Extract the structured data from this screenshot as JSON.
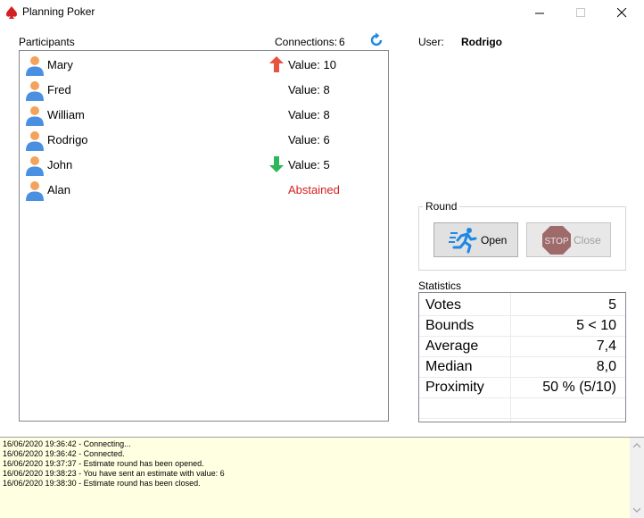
{
  "window": {
    "title": "Planning Poker",
    "minimize_icon": "minimize-icon",
    "maximize_icon": "maximize-icon",
    "close_icon": "close-icon"
  },
  "participants": {
    "label": "Participants",
    "connections_label": "Connections:",
    "connections_count": "6",
    "list": [
      {
        "name": "Mary",
        "value": "Value: 10",
        "indicator": "arrow-up",
        "abstained": false
      },
      {
        "name": "Fred",
        "value": "Value: 8",
        "indicator": "",
        "abstained": false
      },
      {
        "name": "William",
        "value": "Value: 8",
        "indicator": "",
        "abstained": false
      },
      {
        "name": "Rodrigo",
        "value": "Value: 6",
        "indicator": "",
        "abstained": false
      },
      {
        "name": "John",
        "value": "Value: 5",
        "indicator": "arrow-down",
        "abstained": false
      },
      {
        "name": "Alan",
        "value": "Abstained",
        "indicator": "",
        "abstained": true
      }
    ]
  },
  "user": {
    "label": "User:",
    "name": "Rodrigo"
  },
  "round": {
    "label": "Round",
    "open_label": "Open",
    "close_label": "Close",
    "stop_text": "STOP"
  },
  "statistics": {
    "label": "Statistics",
    "rows": [
      {
        "label": "Votes",
        "value": "5"
      },
      {
        "label": "Bounds",
        "value": "5 < 10"
      },
      {
        "label": "Average",
        "value": "7,4"
      },
      {
        "label": "Median",
        "value": "8,0"
      },
      {
        "label": "Proximity",
        "value": "50 % (5/10)"
      }
    ]
  },
  "log": [
    "16/06/2020 19:36:42 - Connecting...",
    "16/06/2020 19:36:42 - Connected.",
    "16/06/2020 19:37:37 - Estimate round has been opened.",
    "16/06/2020 19:38:23 - You have sent an estimate with value: 6",
    "16/06/2020 19:38:30 - Estimate round has been closed."
  ],
  "colors": {
    "arrow_up": "#e8533f",
    "arrow_down": "#2db65b",
    "abstained": "#d42020",
    "log_bg": "#ffffe1",
    "avatar_head": "#f3a35c",
    "avatar_body": "#4a90e2"
  }
}
